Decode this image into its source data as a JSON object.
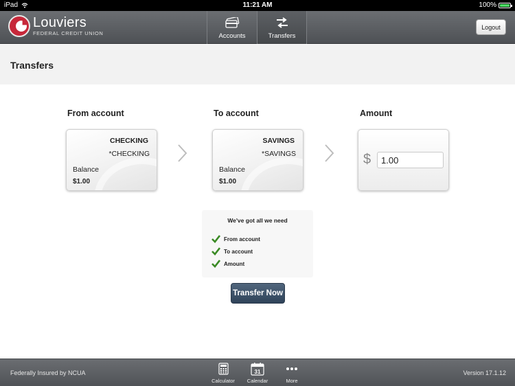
{
  "status_bar": {
    "device": "iPad",
    "time": "11:21 AM",
    "battery": "100%"
  },
  "header": {
    "brand_name": "Louviers",
    "brand_sub": "FEDERAL CREDIT UNION",
    "tabs": [
      {
        "label": "Accounts",
        "icon": "cards-icon",
        "active": false
      },
      {
        "label": "Transfers",
        "icon": "transfer-arrows-icon",
        "active": true
      }
    ],
    "logout_label": "Logout"
  },
  "page": {
    "title": "Transfers"
  },
  "from_account": {
    "label": "From account",
    "name": "CHECKING",
    "sub": "*CHECKING",
    "balance_label": "Balance",
    "balance": "$1.00"
  },
  "to_account": {
    "label": "To account",
    "name": "SAVINGS",
    "sub": "*SAVINGS",
    "balance_label": "Balance",
    "balance": "$1.00"
  },
  "amount": {
    "label": "Amount",
    "currency": "$",
    "value": "1.00"
  },
  "checklist": {
    "title": "We've got all we need",
    "items": [
      "From account",
      "To account",
      "Amount"
    ]
  },
  "transfer_button": "Transfer Now",
  "footer": {
    "insured": "Federally Insured by NCUA",
    "tabs": [
      {
        "label": "Calculator",
        "icon": "calculator-icon"
      },
      {
        "label": "Calendar",
        "icon": "calendar-icon",
        "day": "31"
      },
      {
        "label": "More",
        "icon": "more-icon"
      }
    ],
    "version": "Version 17.1.12"
  },
  "colors": {
    "check_green": "#3a8a24",
    "button_navy": "#2f4359",
    "brand_red": "#c7283a"
  }
}
